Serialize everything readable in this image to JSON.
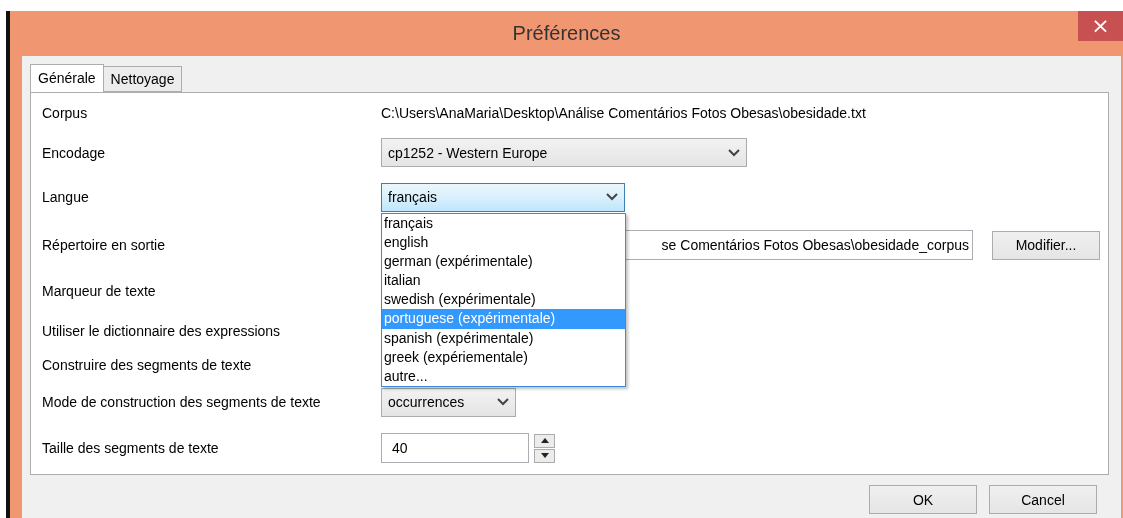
{
  "window": {
    "title": "Préférences",
    "close": "×"
  },
  "tabs": [
    {
      "label": "Générale",
      "selected": true
    },
    {
      "label": "Nettoyage",
      "selected": false
    }
  ],
  "rows": [
    {
      "kind": "text",
      "label": "Corpus",
      "value": "C:\\Users\\AnaMaria\\Desktop\\Análise Comentários Fotos Obesas\\obesidade.txt"
    },
    {
      "kind": "combo",
      "label": "Encodage",
      "value": "cp1252 - Western Europe",
      "open": false
    },
    {
      "kind": "combo",
      "label": "Langue",
      "value": "français",
      "open": true,
      "options": [
        {
          "label": "français",
          "highlighted": false
        },
        {
          "label": "english",
          "highlighted": false
        },
        {
          "label": "german (expérimentale)",
          "highlighted": false
        },
        {
          "label": "italian",
          "highlighted": false
        },
        {
          "label": "swedish (expérimentale)",
          "highlighted": false
        },
        {
          "label": "portuguese (expérimentale)",
          "highlighted": true
        },
        {
          "label": "spanish (expérimentale)",
          "highlighted": false
        },
        {
          "label": "greek (expériementale)",
          "highlighted": false
        },
        {
          "label": "autre...",
          "highlighted": false
        }
      ]
    },
    {
      "kind": "path",
      "label": "Répertoire en sortie",
      "value": "se Comentários Fotos Obesas\\obesidade_corpus",
      "button": "Modifier..."
    },
    {
      "kind": "hidden",
      "label": "Marqueur de texte"
    },
    {
      "kind": "hidden",
      "label": "Utiliser le dictionnaire des expressions"
    },
    {
      "kind": "hidden",
      "label": "Construire des segments de texte"
    },
    {
      "kind": "small-combo",
      "label": "Mode de construction des segments de texte",
      "value": "occurrences",
      "open": false
    },
    {
      "kind": "spin",
      "label": "Taille des segments de texte",
      "value": "40"
    }
  ],
  "buttons": [
    "OK",
    "Cancel"
  ]
}
